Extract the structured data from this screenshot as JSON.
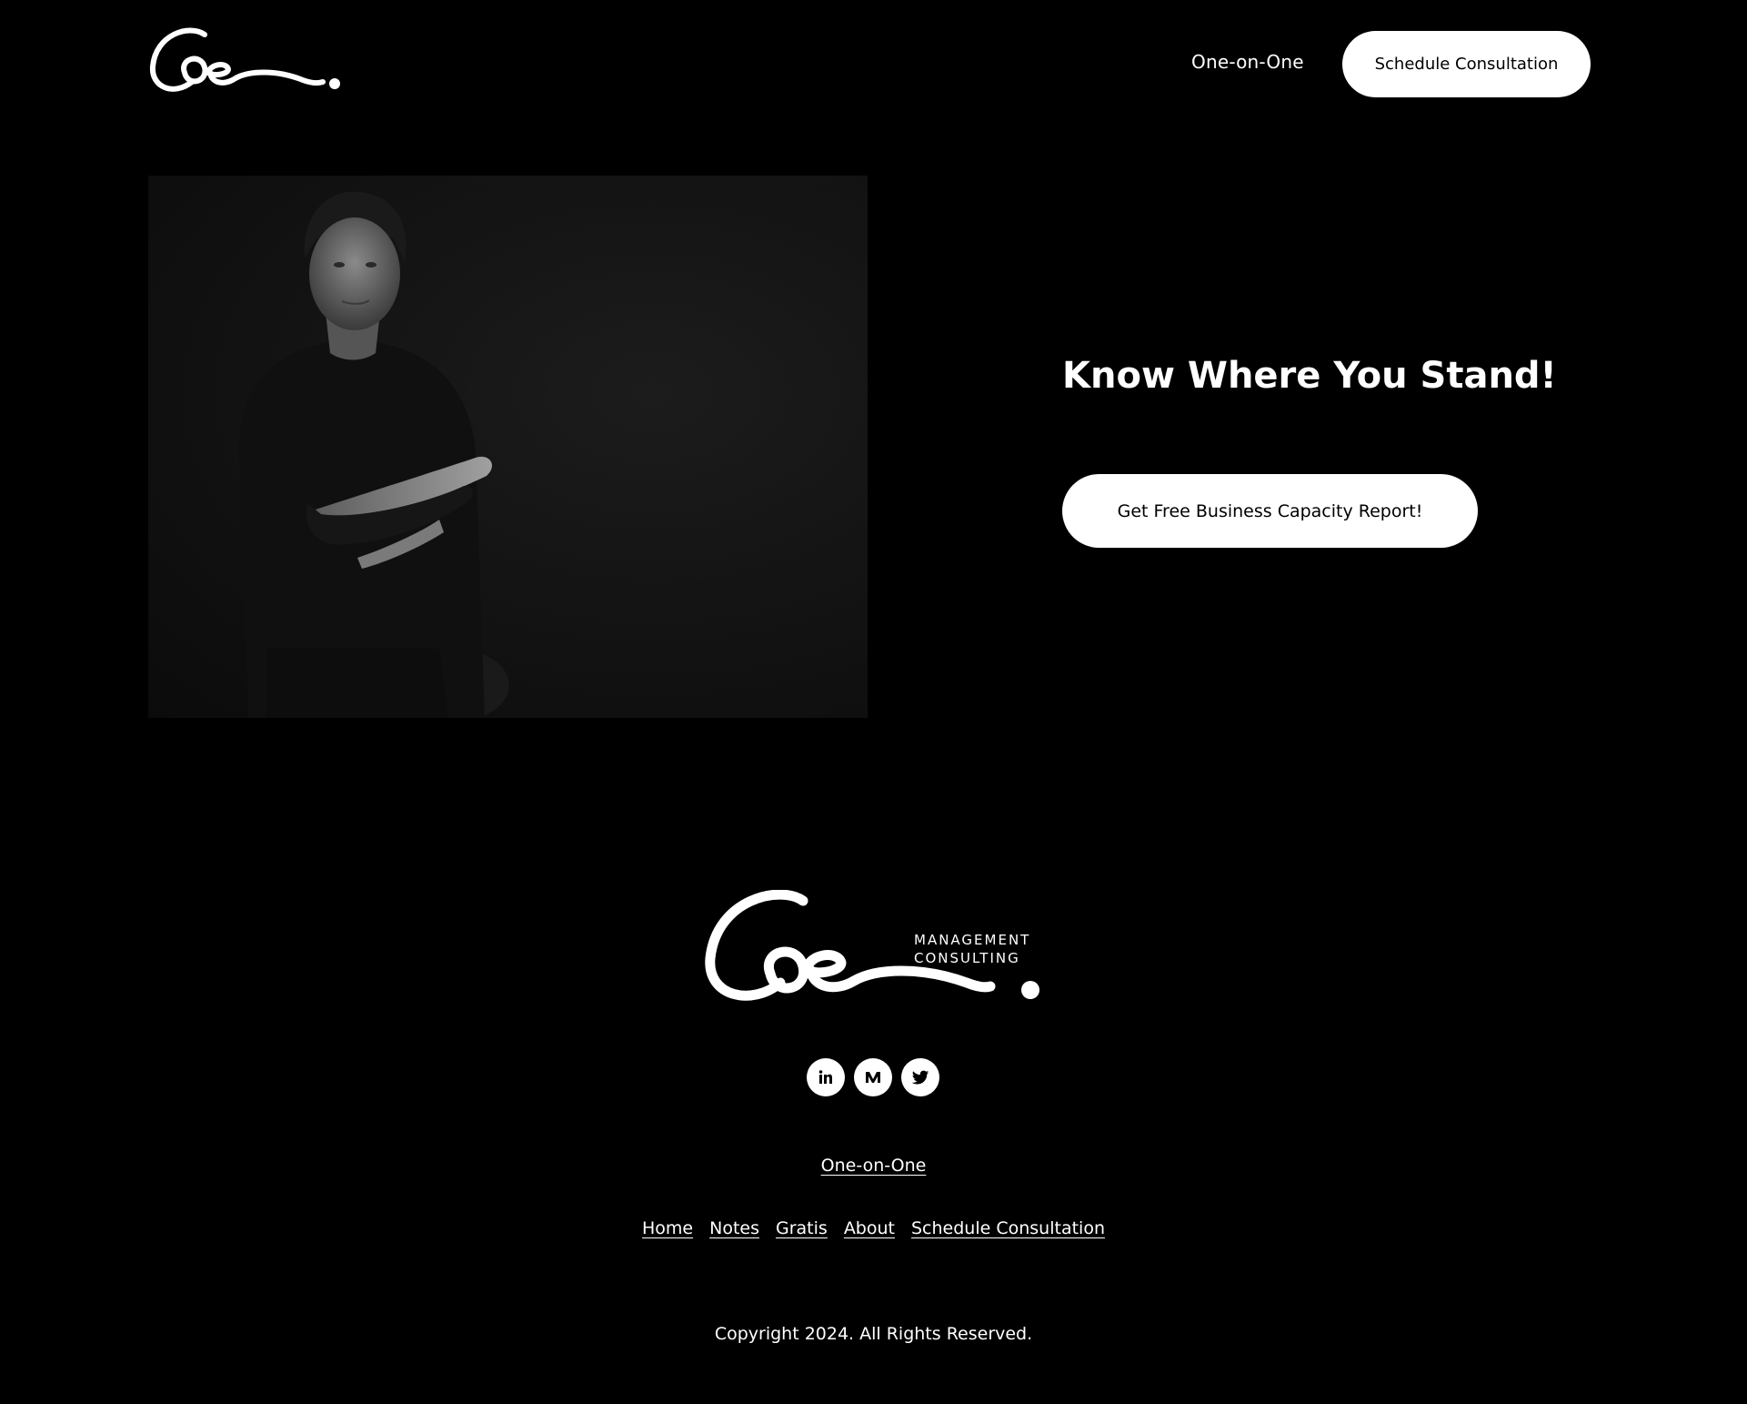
{
  "header": {
    "nav_link": "One-on-One",
    "cta_label": "Schedule Consultation"
  },
  "hero": {
    "title": "Know Where You Stand!",
    "cta_label": "Get Free Business Capacity Report!"
  },
  "footer": {
    "logo_tagline_line1": "MANAGEMENT",
    "logo_tagline_line2": "CONSULTING",
    "social": [
      "linkedin-icon",
      "medium-icon",
      "twitter-icon"
    ],
    "featured_link": "One-on-One",
    "nav": [
      "Home",
      "Notes",
      "Gratis",
      "About",
      "Schedule Consultation"
    ],
    "copyright": "Copyright 2024. All Rights Reserved."
  },
  "colors": {
    "background": "#000000",
    "text": "#ffffff",
    "button_bg": "#ffffff",
    "button_text": "#000000"
  }
}
